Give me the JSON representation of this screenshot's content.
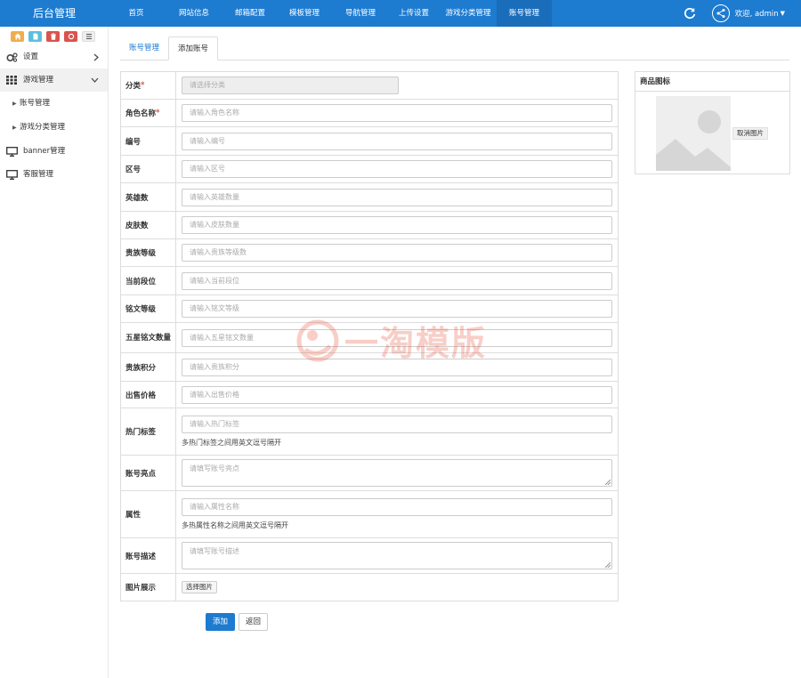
{
  "app": {
    "title": "后台管理"
  },
  "topnav": {
    "items": [
      "首页",
      "网站信息",
      "邮箱配置",
      "模板管理",
      "导航管理",
      "上传设置",
      "游戏分类管理",
      "账号管理"
    ],
    "active_index": 7,
    "user": "欢迎, admin"
  },
  "sidebar": {
    "items": {
      "settings": "设置",
      "game": "游戏管理",
      "account": "账号管理",
      "game_category": "游戏分类管理",
      "banner": "banner管理",
      "service": "客服管理"
    }
  },
  "tabs": {
    "list": "账号管理",
    "add": "添加账号"
  },
  "form": {
    "category": {
      "label": "分类",
      "placeholder": "请选择分类"
    },
    "role_name": {
      "label": "角色名称",
      "placeholder": "请输入角色名称"
    },
    "number": {
      "label": "编号",
      "placeholder": "请输入编号"
    },
    "zone": {
      "label": "区号",
      "placeholder": "请输入区号"
    },
    "heroes": {
      "label": "英雄数",
      "placeholder": "请输入英雄数量"
    },
    "skins": {
      "label": "皮肤数",
      "placeholder": "请输入皮肤数量"
    },
    "noble_level": {
      "label": "贵族等级",
      "placeholder": "请输入贵族等级数"
    },
    "current_rank": {
      "label": "当前段位",
      "placeholder": "请输入当前段位"
    },
    "inscription_level": {
      "label": "铭文等级",
      "placeholder": "请输入铭文等级"
    },
    "five_star": {
      "label": "五星铭文数量",
      "placeholder": "请输入五星铭文数量"
    },
    "noble_points": {
      "label": "贵族积分",
      "placeholder": "请输入贵族积分"
    },
    "price": {
      "label": "出售价格",
      "placeholder": "请输入出售价格"
    },
    "hot_tags": {
      "label": "热门标签",
      "placeholder": "请输入热门标签",
      "help": "多热门标签之间用英文逗号隔开"
    },
    "highlights": {
      "label": "账号亮点",
      "placeholder": "请填写账号亮点"
    },
    "attributes": {
      "label": "属性",
      "placeholder": "请输入属性名称",
      "help": "多热属性名称之间用英文逗号隔开"
    },
    "description": {
      "label": "账号描述",
      "placeholder": "请填写账号描述"
    },
    "images": {
      "label": "图片展示",
      "button": "选择图片"
    }
  },
  "actions": {
    "submit": "添加",
    "back": "返回"
  },
  "image_panel": {
    "title": "商品图标",
    "cancel": "取消图片"
  },
  "watermark": {
    "text": "一淘模版"
  },
  "colors": {
    "primary": "#1d7bd0",
    "required": "#d9534f",
    "watermark": "#e8533a"
  }
}
